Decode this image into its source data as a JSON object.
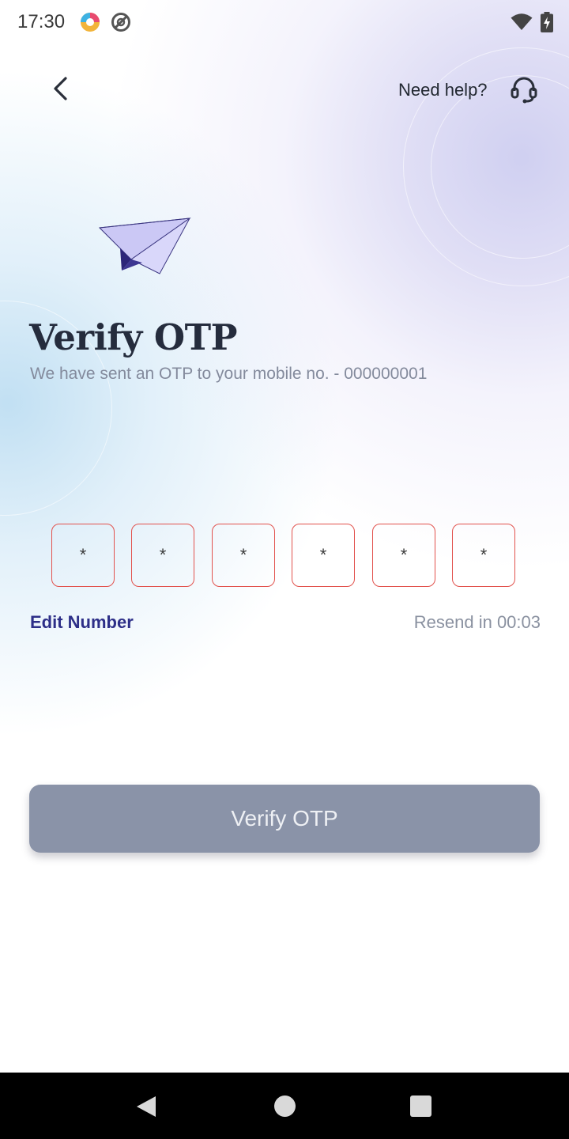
{
  "status_bar": {
    "time": "17:30"
  },
  "header": {
    "back_icon": "chevron-left-icon",
    "help_label": "Need help?",
    "help_icon": "headset-icon"
  },
  "illustration": "paper-plane-icon",
  "main": {
    "title": "Verify OTP",
    "subtitle": "We have sent an OTP to your mobile no.  -  000000001"
  },
  "otp": {
    "digits": [
      "*",
      "*",
      "*",
      "*",
      "*",
      "*"
    ],
    "box_border_color": "#e2524d"
  },
  "actions": {
    "edit_number": "Edit Number",
    "resend": "Resend in 00:03",
    "verify_button": "Verify OTP"
  },
  "colors": {
    "accent": "#2d2f88",
    "button_disabled": "#8a93a8",
    "title": "#252c3d"
  }
}
